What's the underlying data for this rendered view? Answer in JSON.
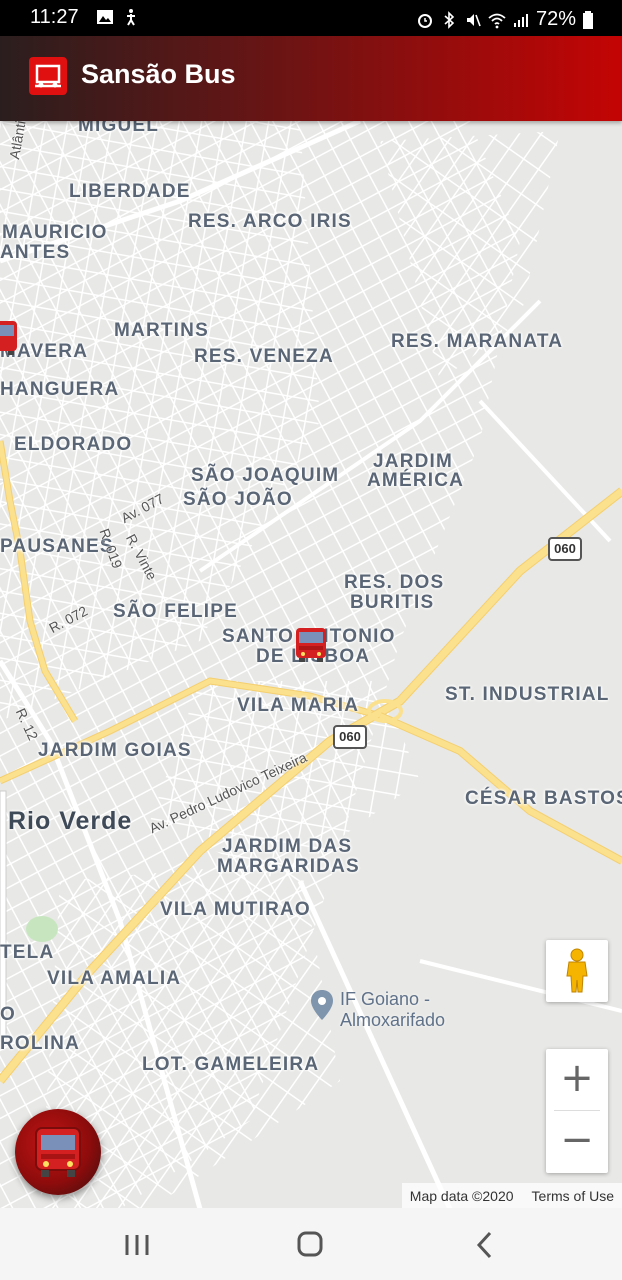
{
  "status_bar": {
    "time": "11:27",
    "battery": "72%",
    "icons": [
      "gallery-icon",
      "accessibility-icon",
      "alarm-icon",
      "bluetooth-icon",
      "mute-icon",
      "wifi-icon",
      "signal-icon",
      "battery-icon"
    ]
  },
  "app_bar": {
    "title": "Sansão Bus",
    "logo_icon": "bus-logo-icon",
    "gradient": [
      "#2b1e1e",
      "#c40404"
    ]
  },
  "map": {
    "neighborhoods": {
      "miguel": "MIGUEL",
      "liberdade": "LIBERDADE",
      "res_arco_iris": "RES. ARCO IRIS",
      "mauricio": "MAURICIO",
      "antes": "ANTES",
      "martins": "MARTINS",
      "mavera": "MAVERA",
      "res_veneza": "RES. VENEZA",
      "res_maranata": "RES. MARANATA",
      "hanguera": "HANGUERA",
      "eldorado": "ELDORADO",
      "sao_joaquim": "SÃO JOAQUIM",
      "sao_joao": "SÃO JOÃO",
      "jardim": "JARDIM",
      "america": "AMÉRICA",
      "pausanes": "PAUSANES",
      "res_dos": "RES. DOS",
      "buritis": "BURITIS",
      "sao_felipe": "SÃO FELIPE",
      "santo_antonio": "SANTO ANTONIO",
      "de_lisboa": "DE LISBOA",
      "st_industrial": "ST. INDUSTRIAL",
      "vila_maria": "VILA MARIA",
      "jardim_goias": "JARDIM GOIAS",
      "cesar_bastos": "CÉSAR BASTOS",
      "jardim_das": "JARDIM DAS",
      "margaridas": "MARGARIDAS",
      "vila_mutirao": "VILA MUTIRAO",
      "tela": "TELA",
      "vila_amalia": "VILA AMALIA",
      "o": "O",
      "rolina": "ROLINA",
      "lot_gameleira": "LOT. GAMELEIRA"
    },
    "city": "Rio Verde",
    "streets": {
      "atlantica": "Atlântica",
      "av_077": "Av. 077",
      "r_019": "R. 019",
      "r_vinte": "R. Vinte",
      "r_072": "R. 072",
      "r_12": "R. 12",
      "av_pedro": "Av. Pedro Ludovico Teixeira"
    },
    "highway_shields": {
      "north": "060",
      "south": "060"
    },
    "poi": {
      "line1": "IF Goiano -",
      "line2": "Almoxarifado",
      "icon": "location-pin-icon"
    },
    "bus_markers": [
      {
        "icon": "bus-marker-icon"
      },
      {
        "icon": "bus-marker-icon"
      }
    ],
    "road_color": "#fbe08e",
    "controls": {
      "pegman_icon": "pegman-icon",
      "zoom_in": "+",
      "zoom_out": "−"
    },
    "attribution": {
      "map_data": "Map data ©2020",
      "terms": "Terms of Use"
    }
  },
  "fab": {
    "icon": "bus-icon",
    "color": "#c21414"
  },
  "nav_bar": {
    "icons": [
      "recent-apps-icon",
      "home-icon",
      "back-icon"
    ]
  }
}
